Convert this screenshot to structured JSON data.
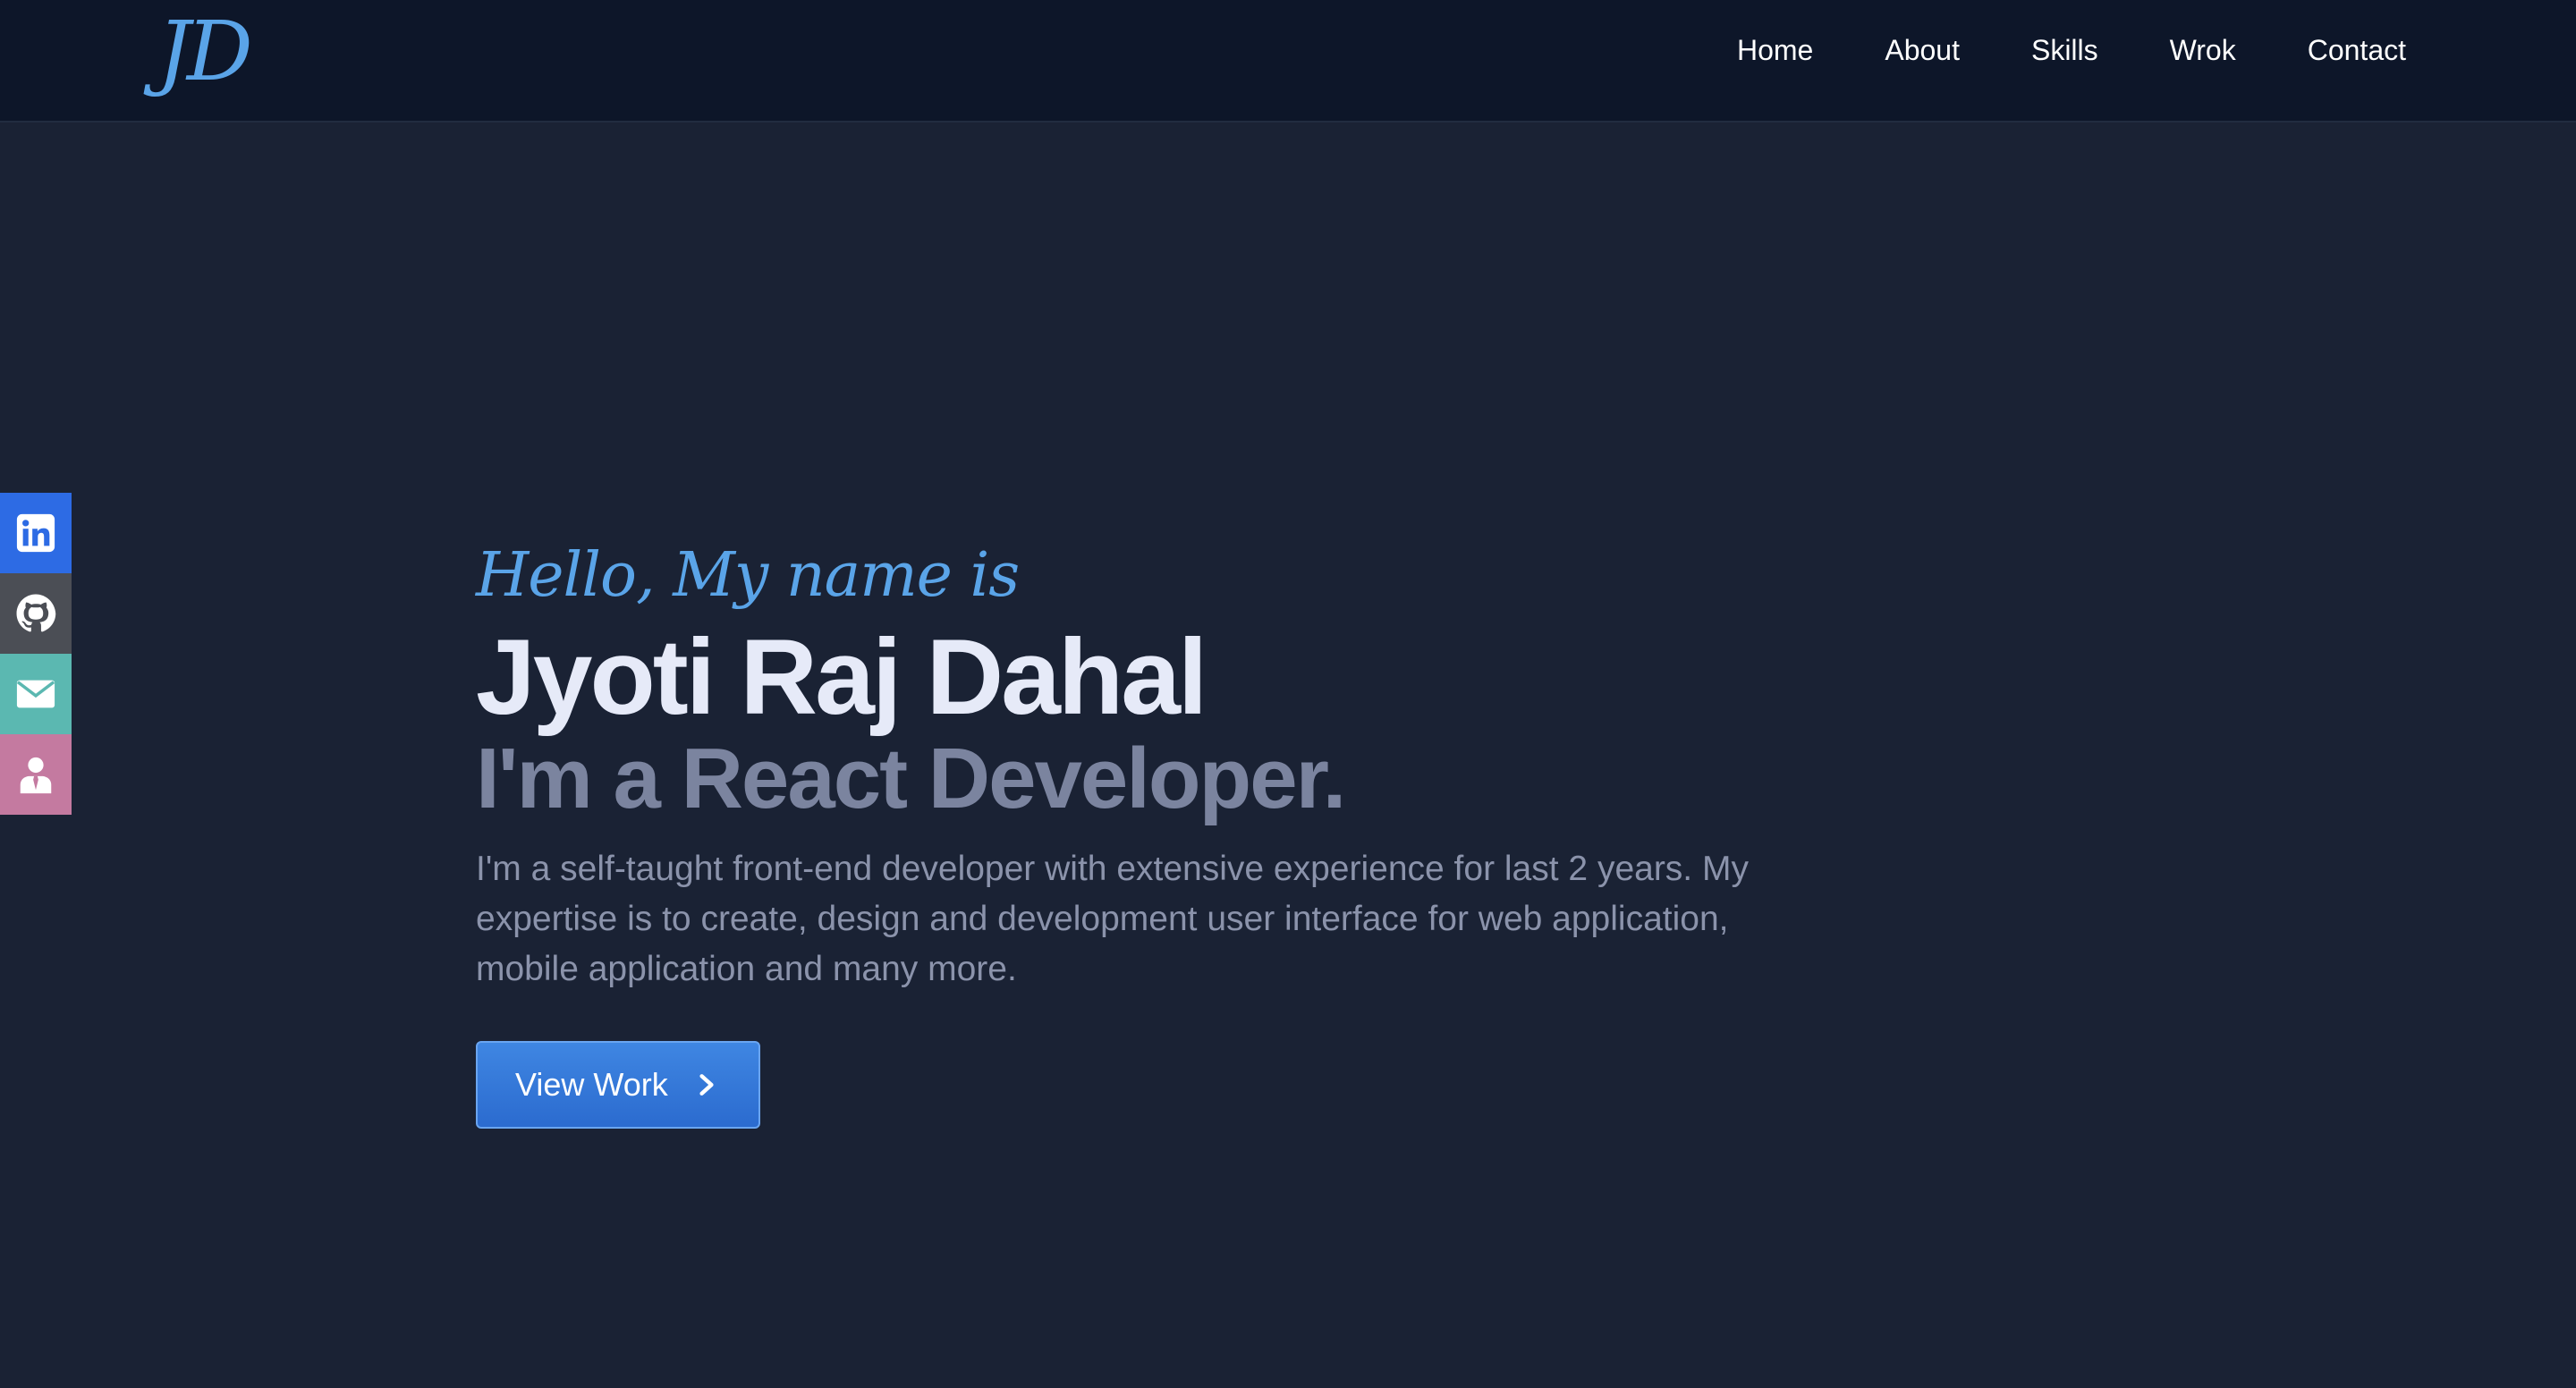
{
  "header": {
    "logo_text": "JD",
    "nav": [
      {
        "label": "Home"
      },
      {
        "label": "About"
      },
      {
        "label": "Skills"
      },
      {
        "label": "Wrok"
      },
      {
        "label": "Contact"
      }
    ]
  },
  "social": [
    {
      "icon": "linkedin-icon",
      "color": "#2d6be4"
    },
    {
      "icon": "github-icon",
      "color": "#4b4e55"
    },
    {
      "icon": "mail-icon",
      "color": "#5bb8b1"
    },
    {
      "icon": "user-icon",
      "color": "#c47aa0"
    }
  ],
  "hero": {
    "greeting": "Hello, My name is",
    "name": "Jyoti Raj Dahal",
    "role": "I'm a React Developer.",
    "bio": "I'm a self-taught front-end developer with extensive experience for last 2 years. My expertise is to create, design and development user interface for web application, mobile application and many more.",
    "cta_label": "View Work",
    "cta_icon": "chevron-right-icon"
  },
  "colors": {
    "background": "#1a2234",
    "navbar": "#0d1629",
    "accent": "#5aa4e8",
    "button": "#2f72d8"
  }
}
